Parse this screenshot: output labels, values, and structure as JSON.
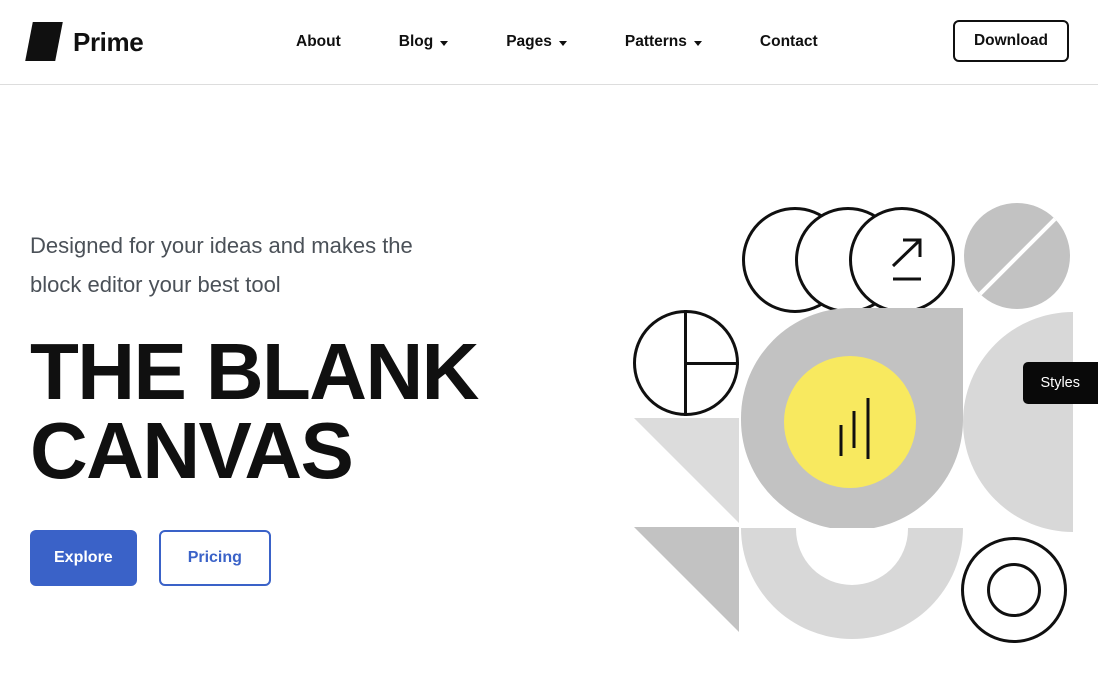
{
  "header": {
    "brand": {
      "name": "Prime",
      "mark_icon": "parallelogram-logo-icon"
    },
    "nav": [
      {
        "label": "About",
        "has_dropdown": false
      },
      {
        "label": "Blog",
        "has_dropdown": true
      },
      {
        "label": "Pages",
        "has_dropdown": true
      },
      {
        "label": "Patterns",
        "has_dropdown": true
      },
      {
        "label": "Contact",
        "has_dropdown": false
      }
    ],
    "download_label": "Download"
  },
  "hero": {
    "subtitle": "Designed for your ideas and makes the block editor your best tool",
    "title": "THE BLANK\nCANVAS",
    "primary_button": "Explore",
    "secondary_button": "Pricing"
  },
  "overlay": {
    "styles_tooltip": "Styles"
  },
  "colors": {
    "ink": "#101010",
    "body_text": "#4b5158",
    "accent_blue": "#3a62c8",
    "accent_yellow": "#f8e95f",
    "grey_mid": "#c2c2c2",
    "grey_light": "#d8d8d8",
    "grey_lighter": "#dcdcdc",
    "border": "#dddddd",
    "background": "#ffffff"
  }
}
